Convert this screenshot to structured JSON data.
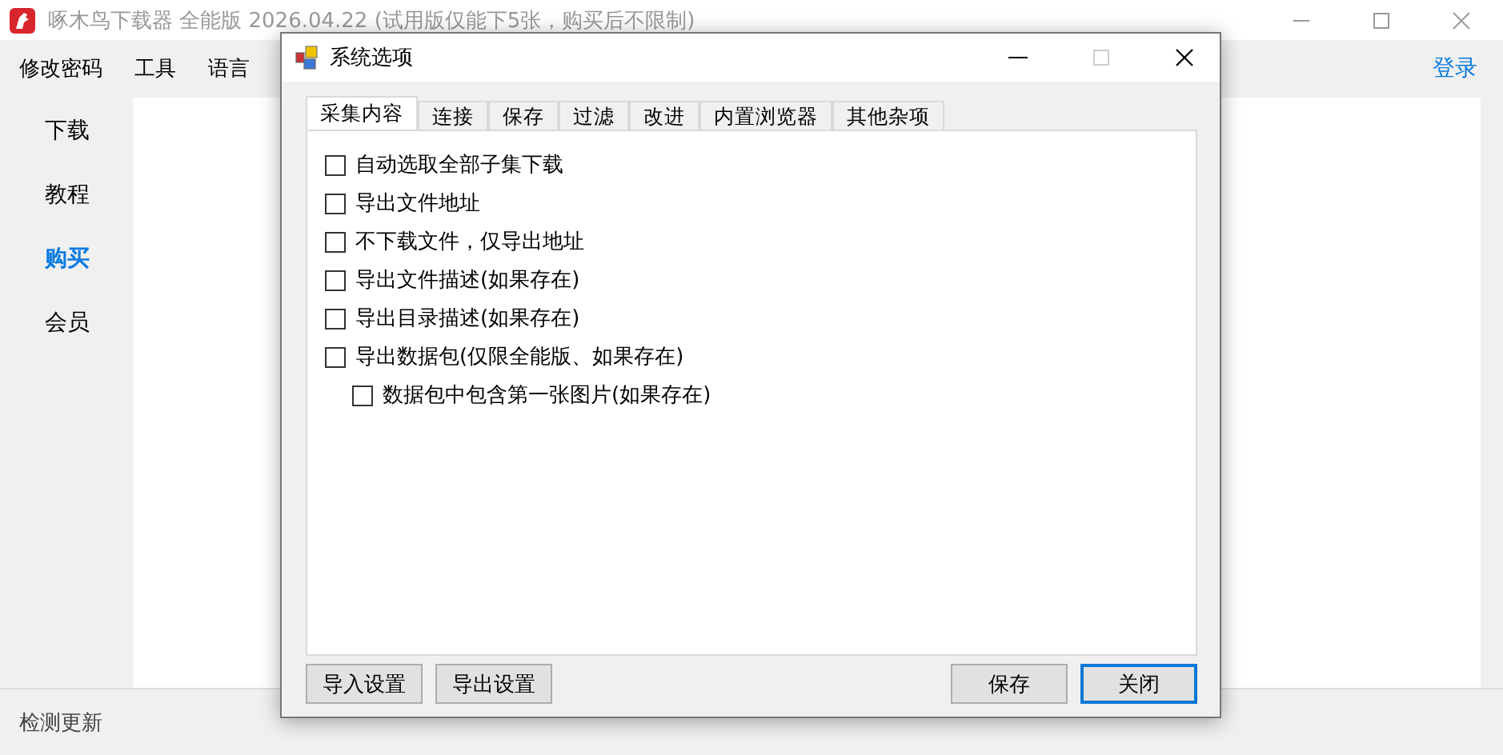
{
  "window": {
    "title": "啄木鸟下载器 全能版 2026.04.22 (试用版仅能下5张，购买后不限制)"
  },
  "menu": [
    "修改密码",
    "工具",
    "语言"
  ],
  "login_link": "登录",
  "sidebar": {
    "items": [
      {
        "label": "下载",
        "selected": false
      },
      {
        "label": "教程",
        "selected": false
      },
      {
        "label": "购买",
        "selected": true
      },
      {
        "label": "会员",
        "selected": false
      }
    ]
  },
  "status_bar": "检测更新",
  "dialog": {
    "title": "系统选项",
    "tabs": [
      {
        "label": "采集内容",
        "selected": true
      },
      {
        "label": "连接",
        "selected": false
      },
      {
        "label": "保存",
        "selected": false
      },
      {
        "label": "过滤",
        "selected": false
      },
      {
        "label": "改进",
        "selected": false
      },
      {
        "label": "内置浏览器",
        "selected": false
      },
      {
        "label": "其他杂项",
        "selected": false
      }
    ],
    "options": [
      {
        "label": "自动选取全部子集下载",
        "checked": false
      },
      {
        "label": "导出文件地址",
        "checked": false
      },
      {
        "label": "不下载文件，仅导出地址",
        "checked": false
      },
      {
        "label": "导出文件描述(如果存在)",
        "checked": false
      },
      {
        "label": "导出目录描述(如果存在)",
        "checked": false
      },
      {
        "label": "导出数据包(仅限全能版、如果存在)",
        "checked": false,
        "children": [
          {
            "label": "数据包中包含第一张图片(如果存在)",
            "checked": false
          }
        ]
      }
    ],
    "left_buttons": [
      {
        "label": "导入设置",
        "focused": false
      },
      {
        "label": "导出设置",
        "focused": false
      }
    ],
    "right_buttons": [
      {
        "label": "保存",
        "focused": false
      },
      {
        "label": "关闭",
        "focused": true
      }
    ]
  }
}
